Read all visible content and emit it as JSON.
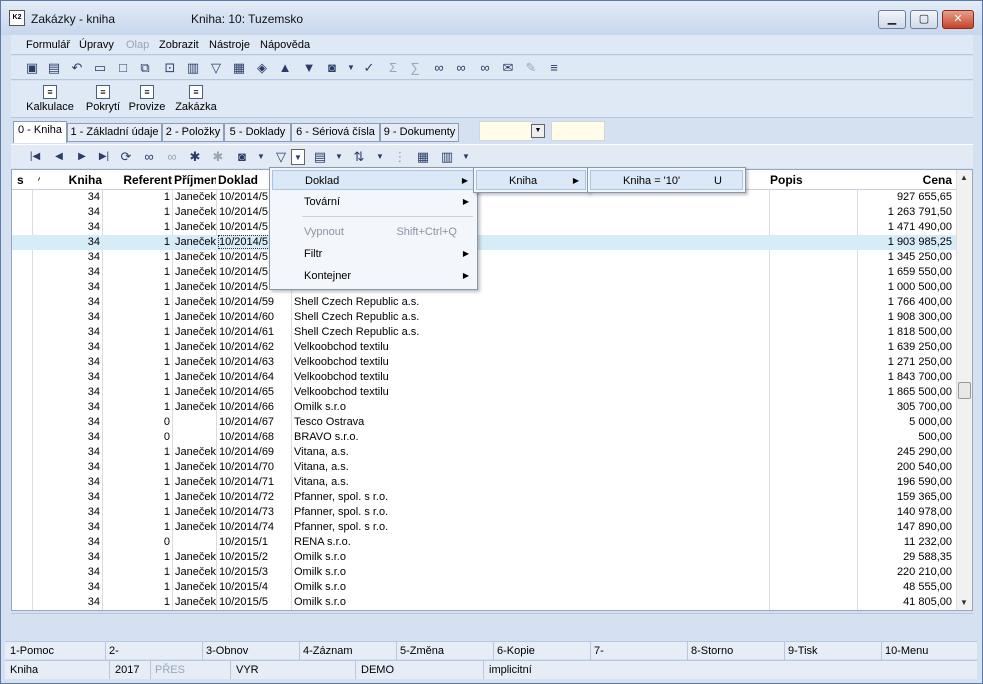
{
  "window": {
    "title": "Zakázky - kniha",
    "book": "Kniha: 10: Tuzemsko",
    "icon_text": "K2"
  },
  "menubar": [
    {
      "label": "Formulář",
      "disabled": false
    },
    {
      "label": "Úpravy",
      "disabled": false
    },
    {
      "label": "Olap",
      "disabled": true
    },
    {
      "label": "Zobrazit",
      "disabled": false
    },
    {
      "label": "Nástroje",
      "disabled": false
    },
    {
      "label": "Nápověda",
      "disabled": false
    }
  ],
  "toolbar2": [
    {
      "label": "Kalkulace"
    },
    {
      "label": "Pokrytí"
    },
    {
      "label": "Provize"
    },
    {
      "label": "Zakázka"
    }
  ],
  "tabs": [
    "0 - Kniha",
    "1 - Základní údaje",
    "2 - Položky",
    "5 - Doklady",
    "6 - Sériová čísla",
    "9 - Dokumenty"
  ],
  "grid": {
    "headers": {
      "s": "s",
      "sort": "⁄",
      "kniha": "Kniha",
      "referent": "Referent",
      "prijmeni": "Příjmení",
      "doklad": "Doklad",
      "popis": "Popis",
      "cena": "Cena"
    },
    "rows": [
      {
        "kniha": "34",
        "ref": "1",
        "prijmeni": "Janeček",
        "doklad": "10/2014/5",
        "firma": "",
        "cena": "927 655,65"
      },
      {
        "kniha": "34",
        "ref": "1",
        "prijmeni": "Janeček",
        "doklad": "10/2014/5",
        "firma": "",
        "cena": "1 263 791,50"
      },
      {
        "kniha": "34",
        "ref": "1",
        "prijmeni": "Janeček",
        "doklad": "10/2014/5",
        "firma": "",
        "cena": "1 471 490,00"
      },
      {
        "kniha": "34",
        "ref": "1",
        "prijmeni": "Janeček",
        "doklad": "10/2014/5",
        "firma": "",
        "cena": "1 903 985,25"
      },
      {
        "kniha": "34",
        "ref": "1",
        "prijmeni": "Janeček",
        "doklad": "10/2014/5",
        "firma": "",
        "cena": "1 345 250,00"
      },
      {
        "kniha": "34",
        "ref": "1",
        "prijmeni": "Janeček",
        "doklad": "10/2014/5",
        "firma": "",
        "cena": "1 659 550,00"
      },
      {
        "kniha": "34",
        "ref": "1",
        "prijmeni": "Janeček",
        "doklad": "10/2014/5",
        "firma": "",
        "cena": "1 000 500,00"
      },
      {
        "kniha": "34",
        "ref": "1",
        "prijmeni": "Janeček",
        "doklad": "10/2014/59",
        "firma": "Shell Czech Republic a.s.",
        "cena": "1 766 400,00"
      },
      {
        "kniha": "34",
        "ref": "1",
        "prijmeni": "Janeček",
        "doklad": "10/2014/60",
        "firma": "Shell Czech Republic a.s.",
        "cena": "1 908 300,00"
      },
      {
        "kniha": "34",
        "ref": "1",
        "prijmeni": "Janeček",
        "doklad": "10/2014/61",
        "firma": "Shell Czech Republic a.s.",
        "cena": "1 818 500,00"
      },
      {
        "kniha": "34",
        "ref": "1",
        "prijmeni": "Janeček",
        "doklad": "10/2014/62",
        "firma": "Velkoobchod textilu",
        "cena": "1 639 250,00"
      },
      {
        "kniha": "34",
        "ref": "1",
        "prijmeni": "Janeček",
        "doklad": "10/2014/63",
        "firma": "Velkoobchod textilu",
        "cena": "1 271 250,00"
      },
      {
        "kniha": "34",
        "ref": "1",
        "prijmeni": "Janeček",
        "doklad": "10/2014/64",
        "firma": "Velkoobchod textilu",
        "cena": "1 843 700,00"
      },
      {
        "kniha": "34",
        "ref": "1",
        "prijmeni": "Janeček",
        "doklad": "10/2014/65",
        "firma": "Velkoobchod textilu",
        "cena": "1 865 500,00"
      },
      {
        "kniha": "34",
        "ref": "1",
        "prijmeni": "Janeček",
        "doklad": "10/2014/66",
        "firma": "Omilk s.r.o",
        "cena": "305 700,00"
      },
      {
        "kniha": "34",
        "ref": "0",
        "prijmeni": "",
        "doklad": "10/2014/67",
        "firma": "Tesco Ostrava",
        "cena": "5 000,00"
      },
      {
        "kniha": "34",
        "ref": "0",
        "prijmeni": "",
        "doklad": "10/2014/68",
        "firma": "BRAVO s.r.o.",
        "cena": "500,00"
      },
      {
        "kniha": "34",
        "ref": "1",
        "prijmeni": "Janeček",
        "doklad": "10/2014/69",
        "firma": "Vitana, a.s.",
        "cena": "245 290,00"
      },
      {
        "kniha": "34",
        "ref": "1",
        "prijmeni": "Janeček",
        "doklad": "10/2014/70",
        "firma": "Vitana, a.s.",
        "cena": "200 540,00"
      },
      {
        "kniha": "34",
        "ref": "1",
        "prijmeni": "Janeček",
        "doklad": "10/2014/71",
        "firma": "Vitana, a.s.",
        "cena": "196 590,00"
      },
      {
        "kniha": "34",
        "ref": "1",
        "prijmeni": "Janeček",
        "doklad": "10/2014/72",
        "firma": "Pfanner, spol. s r.o.",
        "cena": "159 365,00"
      },
      {
        "kniha": "34",
        "ref": "1",
        "prijmeni": "Janeček",
        "doklad": "10/2014/73",
        "firma": "Pfanner, spol. s r.o.",
        "cena": "140 978,00"
      },
      {
        "kniha": "34",
        "ref": "1",
        "prijmeni": "Janeček",
        "doklad": "10/2014/74",
        "firma": "Pfanner, spol. s r.o.",
        "cena": "147 890,00"
      },
      {
        "kniha": "34",
        "ref": "0",
        "prijmeni": "",
        "doklad": "10/2015/1",
        "firma": "RENA s.r.o.",
        "cena": "11 232,00"
      },
      {
        "kniha": "34",
        "ref": "1",
        "prijmeni": "Janeček",
        "doklad": "10/2015/2",
        "firma": "Omilk s.r.o",
        "cena": "29 588,35"
      },
      {
        "kniha": "34",
        "ref": "1",
        "prijmeni": "Janeček",
        "doklad": "10/2015/3",
        "firma": "Omilk s.r.o",
        "cena": "220 210,00"
      },
      {
        "kniha": "34",
        "ref": "1",
        "prijmeni": "Janeček",
        "doklad": "10/2015/4",
        "firma": "Omilk s.r.o",
        "cena": "48 555,00"
      },
      {
        "kniha": "34",
        "ref": "1",
        "prijmeni": "Janeček",
        "doklad": "10/2015/5",
        "firma": "Omilk s.r.o",
        "cena": "41 805,00"
      }
    ],
    "selected_row": 3
  },
  "context_menu": {
    "items": [
      {
        "label": "Doklad",
        "shortcut": "",
        "submenu": true,
        "disabled": false,
        "highlight": true
      },
      {
        "label": "Tovární",
        "shortcut": "",
        "submenu": true,
        "disabled": false,
        "highlight": false
      },
      {
        "label": "Vypnout",
        "shortcut": "Shift+Ctrl+Q",
        "submenu": false,
        "disabled": true,
        "highlight": false
      },
      {
        "label": "Filtr",
        "shortcut": "",
        "submenu": true,
        "disabled": false,
        "highlight": false
      },
      {
        "label": "Kontejner",
        "shortcut": "",
        "submenu": true,
        "disabled": false,
        "highlight": false
      }
    ],
    "sub1": {
      "label": "Kniha"
    },
    "sub2": {
      "label": "Kniha = '10'",
      "shortcut": "U"
    }
  },
  "fkeys": [
    "1-Pomoc",
    "2-",
    "3-Obnov",
    "4-Záznam",
    "5-Změna",
    "6-Kopie",
    "7-",
    "8-Storno",
    "9-Tisk",
    "10-Menu"
  ],
  "statusbar": {
    "kniha": "Kniha",
    "year": "2017",
    "pres": "PŘES",
    "vyr": "VYR",
    "demo": "DEMO",
    "implicit": "implicitní"
  },
  "colors": {
    "selected_row": "#d6ecf8",
    "menu_highlight": "#dbe8f7",
    "input_bg": "#fffde8"
  }
}
